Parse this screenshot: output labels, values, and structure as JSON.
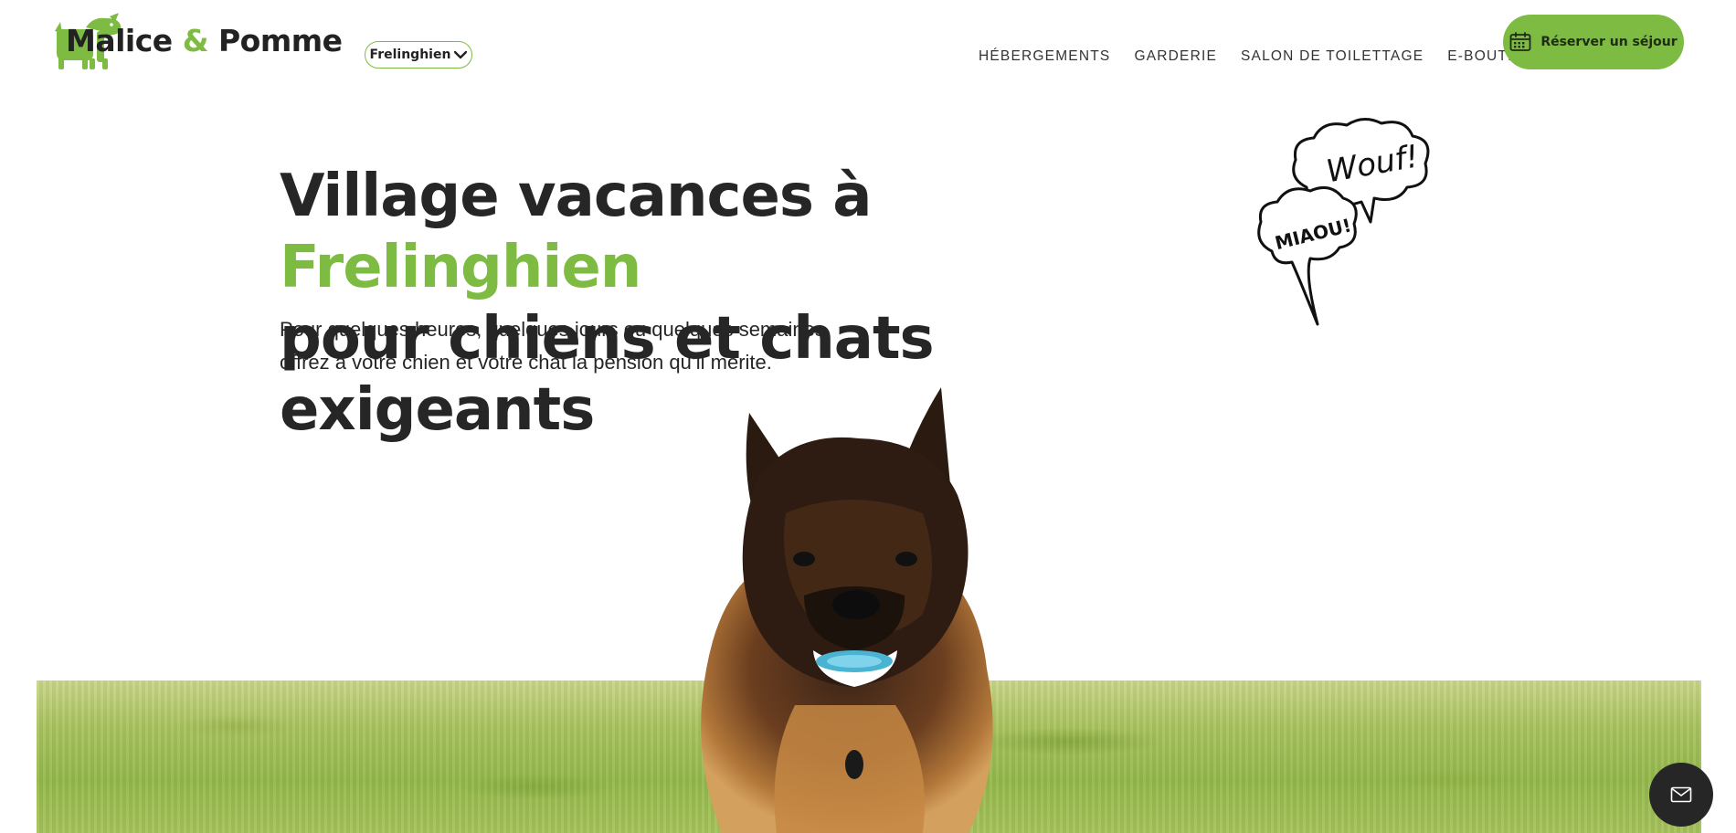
{
  "header": {
    "brand": {
      "name_part1": "Malice",
      "amp": "&",
      "name_part2": "Pomme"
    },
    "location": {
      "selected": "Frelinghien"
    },
    "nav": [
      {
        "label": "HÉBERGEMENTS"
      },
      {
        "label": "GARDERIE"
      },
      {
        "label": "SALON DE TOILETTAGE"
      },
      {
        "label": "E-BOUTIQUE"
      }
    ],
    "cta": {
      "label": "Réserver un séjour",
      "icon": "calendar-icon"
    }
  },
  "hero": {
    "title_prefix": "Village vacances à ",
    "title_accent": "Frelinghien",
    "title_line2": "pour chiens et chats exigeants",
    "subtitle_line1": "Pour quelques heures, quelques jours ou quelques semaines,",
    "subtitle_line2": "offrez à votre chien et votre chat la pension qu’il mérite.",
    "bubble_dog": "Wouf!",
    "bubble_cat": "MIAOU!"
  },
  "fab": {
    "icon": "mail-icon"
  },
  "colors": {
    "accent": "#7dbb43",
    "dark": "#262626",
    "text": "#222222"
  }
}
